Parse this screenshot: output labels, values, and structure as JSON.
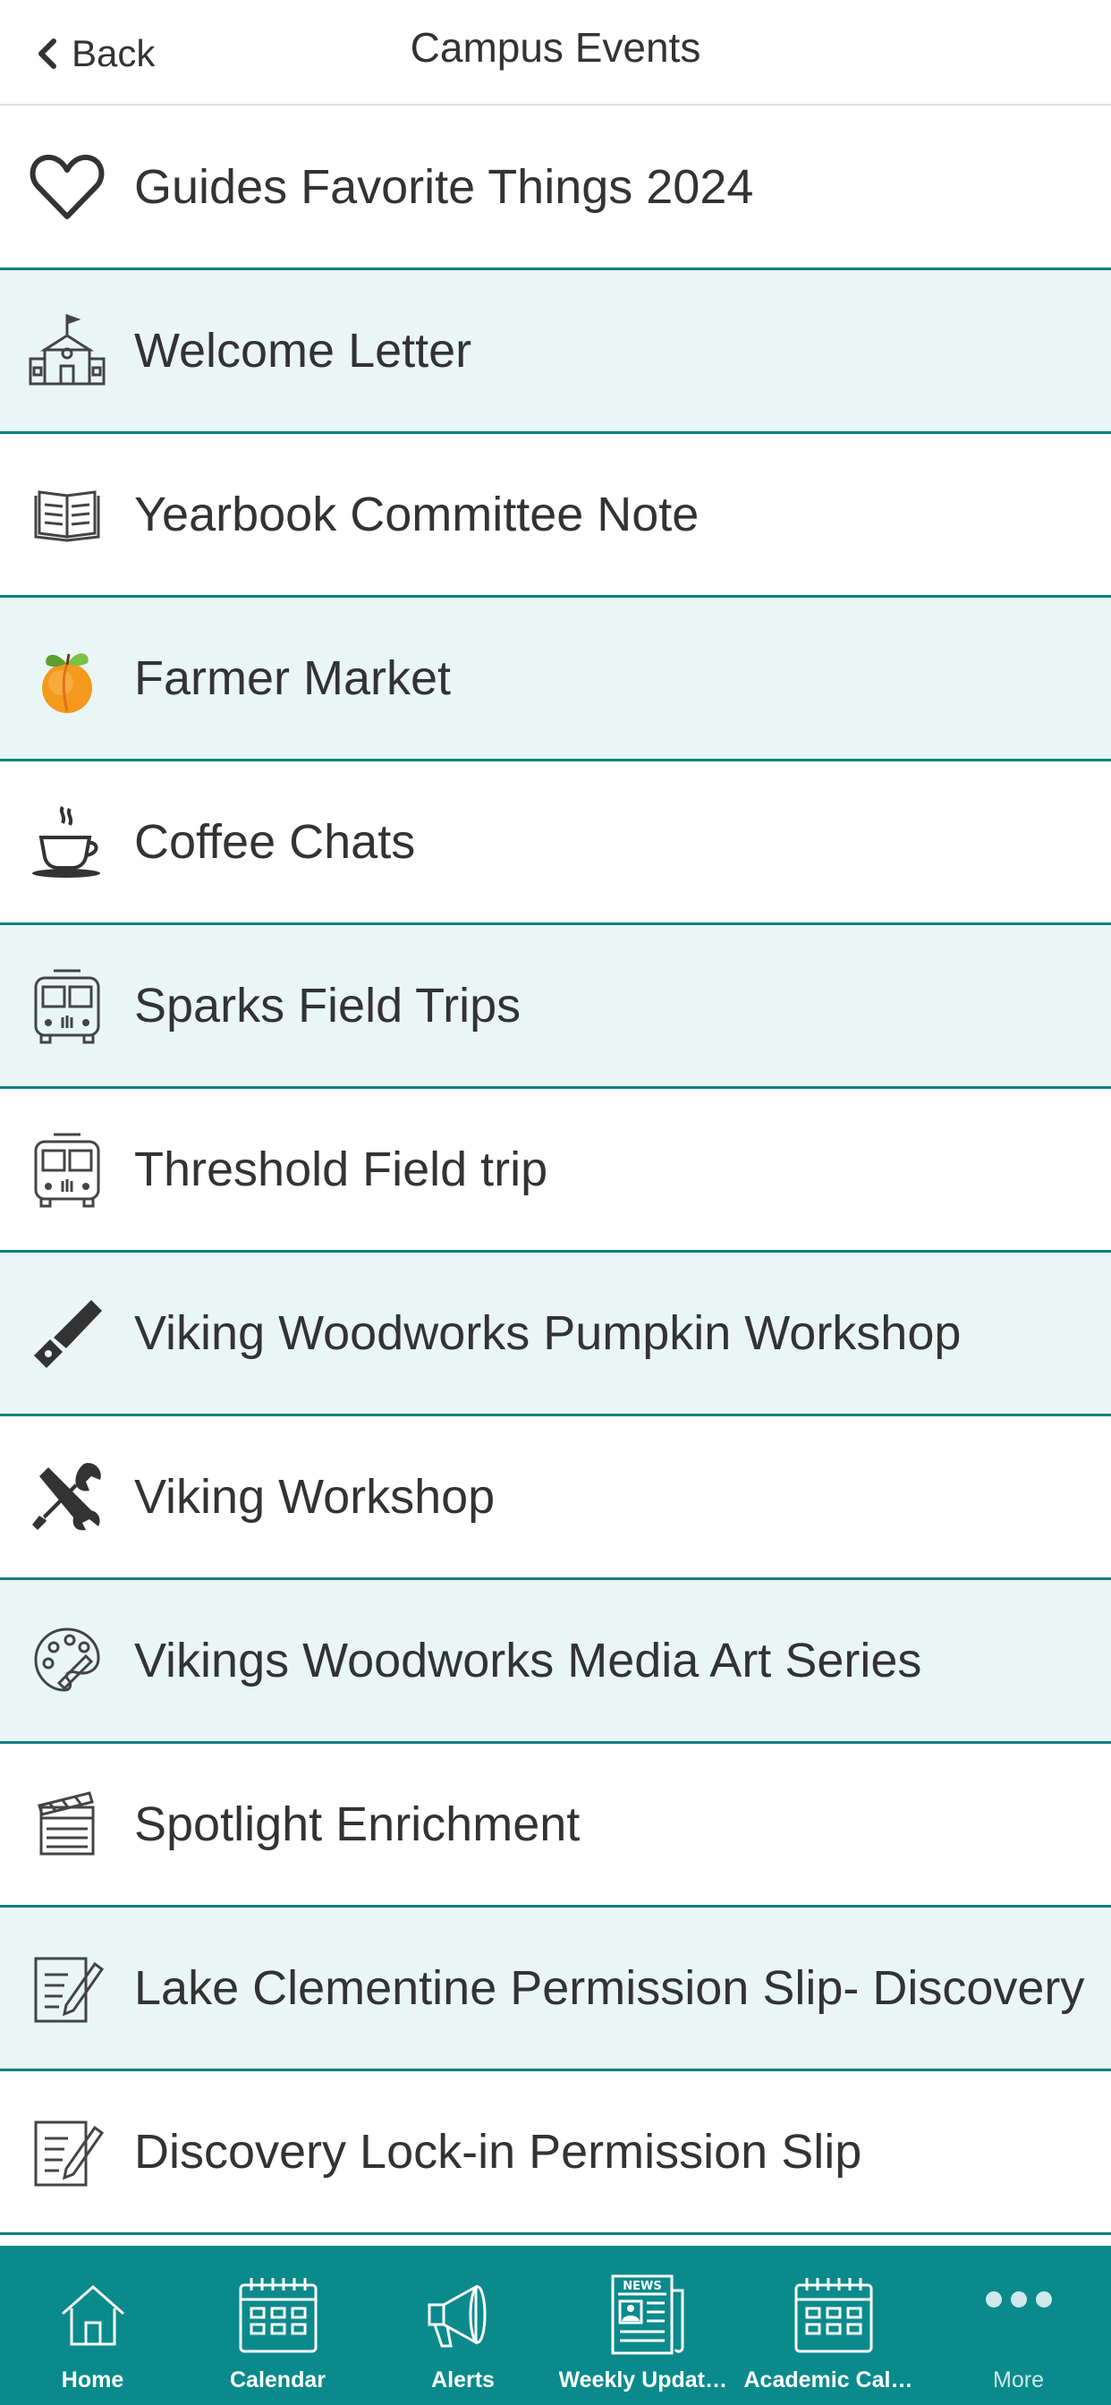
{
  "header": {
    "back_label": "Back",
    "title": "Campus Events"
  },
  "list": [
    {
      "label": "Guides Favorite Things 2024",
      "icon": "heart-icon"
    },
    {
      "label": "Welcome Letter",
      "icon": "school-icon"
    },
    {
      "label": "Yearbook Committee Note",
      "icon": "book-icon"
    },
    {
      "label": "Farmer Market",
      "icon": "peach-icon"
    },
    {
      "label": "Coffee Chats",
      "icon": "coffee-cup-icon"
    },
    {
      "label": "Sparks Field Trips",
      "icon": "bus-icon"
    },
    {
      "label": "Threshold Field trip",
      "icon": "bus-icon"
    },
    {
      "label": "Viking Woodworks Pumpkin Workshop",
      "icon": "saw-icon"
    },
    {
      "label": "Viking Workshop",
      "icon": "tools-icon"
    },
    {
      "label": "Vikings Woodworks Media Art Series",
      "icon": "palette-icon"
    },
    {
      "label": "Spotlight Enrichment",
      "icon": "clapperboard-icon"
    },
    {
      "label": "Lake Clementine Permission Slip- Discovery",
      "icon": "document-pen-icon"
    },
    {
      "label": "Discovery Lock-in Permission Slip",
      "icon": "document-pen-icon"
    }
  ],
  "tabbar": [
    {
      "label": "Home",
      "icon": "home-icon"
    },
    {
      "label": "Calendar",
      "icon": "calendar-icon"
    },
    {
      "label": "Alerts",
      "icon": "megaphone-icon"
    },
    {
      "label": "Weekly Updates...",
      "icon": "newspaper-icon",
      "icon_text": "NEWS"
    },
    {
      "label": "Academic Calen...",
      "icon": "calendar-icon"
    },
    {
      "label": "More",
      "icon": "more-dots-icon"
    }
  ],
  "colors": {
    "accent": "#0b8a8c",
    "row_divider": "#0b8080",
    "row_alt_bg": "#eaf6f6"
  }
}
